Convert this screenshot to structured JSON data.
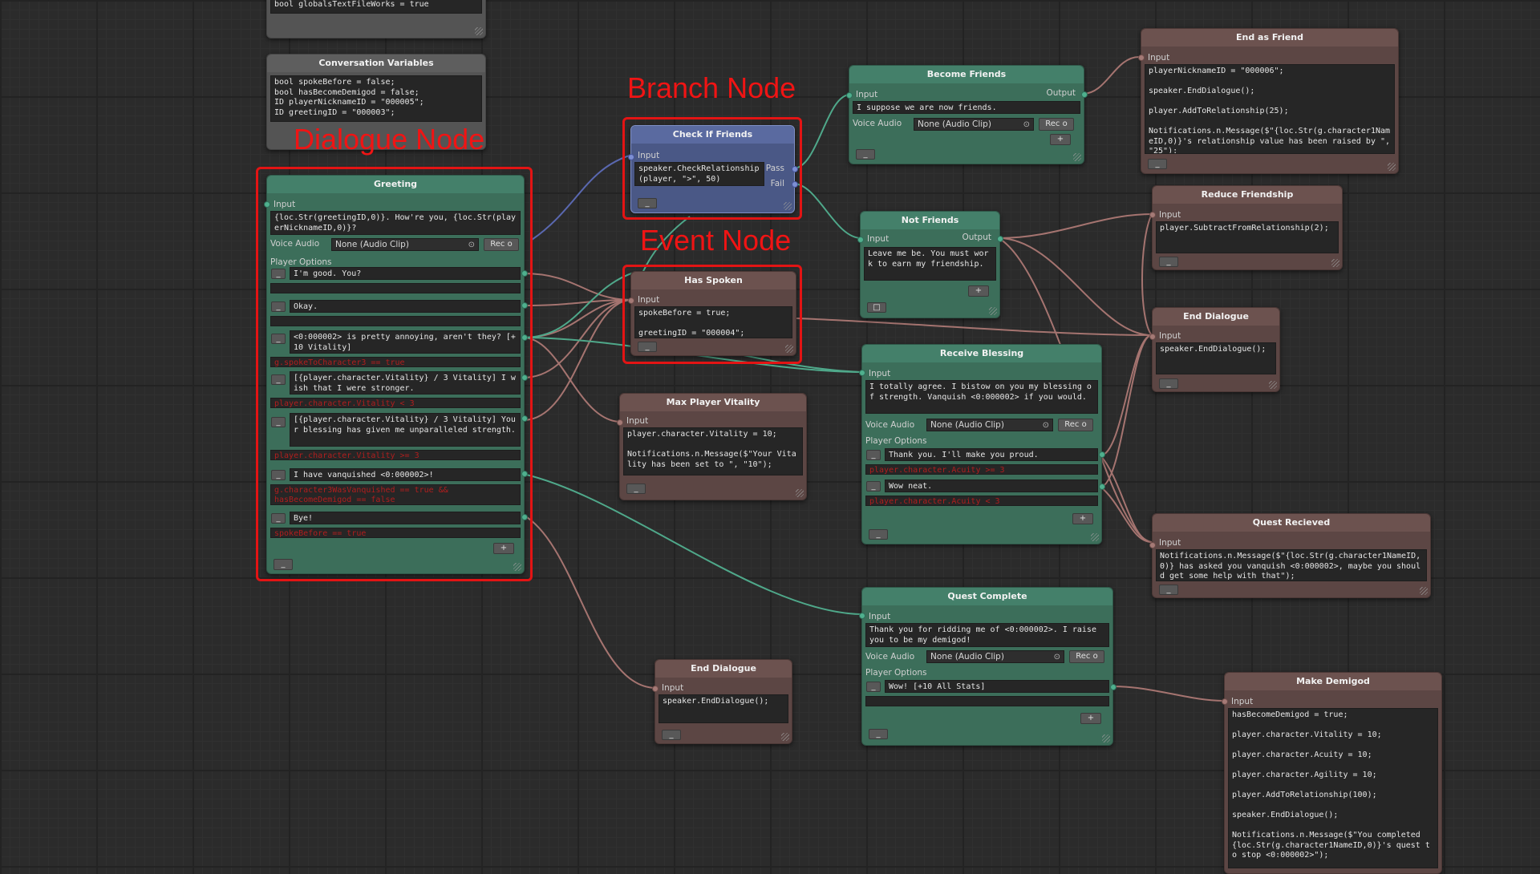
{
  "annotations": {
    "branch_node": "Branch Node",
    "dialogue_node": "Dialogue Node",
    "event_node": "Event Node"
  },
  "common": {
    "input": "Input",
    "output": "Output",
    "voice_audio": "Voice Audio",
    "audio_clip": "None (Audio Clip)",
    "record": "Rec o",
    "player_options": "Player Options",
    "minus": "_",
    "plus": "+",
    "square": "□",
    "target_glyph": "⊙"
  },
  "globals_node": {
    "text": "bool globalsTextFileWorks = true"
  },
  "conversation_variables": {
    "title": "Conversation Variables",
    "code": "bool spokeBefore = false;\nbool hasBecomeDemigod = false;\nID playerNicknameID = \"000005\";\nID greetingID = \"000003\";"
  },
  "greeting": {
    "title": "Greeting",
    "text": "{loc.Str(greetingID,0)}. How're you, {loc.Str(playerNicknameID,0)}?",
    "options": [
      {
        "text": "I'm good. You?",
        "condition": ""
      },
      {
        "text": "Okay.",
        "condition": ""
      },
      {
        "text": "<0:000002> is pretty annoying, aren't they? [+10 Vitality]",
        "condition": "g.spokeToCharacter3 == true"
      },
      {
        "text": "[{player.character.Vitality} / 3 Vitality] I wish that I were stronger.",
        "condition": "player.character.Vitality < 3"
      },
      {
        "text": "[{player.character.Vitality} / 3 Vitality] Your blessing has given me unparalleled strength.",
        "condition": "player.character.Vitality >= 3"
      },
      {
        "text": "I have vanquished <0:000002>!",
        "condition": "g.character3WasVanquished == true &&\nhasBecomeDemigod == false"
      },
      {
        "text": "Bye!",
        "condition": "spokeBefore == true"
      }
    ]
  },
  "check_if_friends": {
    "title": "Check If Friends",
    "code": "speaker.CheckRelationship(player, \">\", 50)",
    "pass": "Pass",
    "fail": "Fail"
  },
  "has_spoken": {
    "title": "Has Spoken",
    "code": "spokeBefore = true;\n\ngreetingID = \"000004\";"
  },
  "max_player_vitality": {
    "title": "Max Player Vitality",
    "code": "player.character.Vitality = 10;\n\nNotifications.n.Message($\"Your Vitality has been set to \", \"10\");"
  },
  "end_dialogue_bottom": {
    "title": "End Dialogue",
    "code": "speaker.EndDialogue();"
  },
  "become_friends": {
    "title": "Become Friends",
    "text": "I suppose we are now friends."
  },
  "not_friends": {
    "title": "Not Friends",
    "text": "Leave me be. You must work to earn my friendship."
  },
  "receive_blessing": {
    "title": "Receive Blessing",
    "text": "I totally agree. I bistow on you my blessing of strength. Vanquish <0:000002> if you would.",
    "options": [
      {
        "text": "Thank you. I'll make you proud.",
        "condition": "player.character.Acuity >= 3"
      },
      {
        "text": "Wow neat.",
        "condition": "player.character.Acuity < 3"
      }
    ]
  },
  "quest_complete": {
    "title": "Quest Complete",
    "text": "Thank you for ridding me of <0:000002>. I raise you to be my demigod!",
    "options": [
      {
        "text": "Wow! [+10 All Stats]",
        "condition": ""
      }
    ]
  },
  "end_as_friend": {
    "title": "End as Friend",
    "code": "playerNicknameID = \"000006\";\n\nspeaker.EndDialogue();\n\nplayer.AddToRelationship(25);\n\nNotifications.n.Message($\"{loc.Str(g.character1NameID,0)}'s relationship value has been raised by \", \"25\");"
  },
  "reduce_friendship": {
    "title": "Reduce Friendship",
    "code": "player.SubtractFromRelationship(2);"
  },
  "end_dialogue_right": {
    "title": "End Dialogue",
    "code": "speaker.EndDialogue();"
  },
  "quest_recieved": {
    "title": "Quest Recieved",
    "code": "Notifications.n.Message($\"{loc.Str(g.character1NameID,0)} has asked you vanquish <0:000002>, maybe you should get some help with that\");"
  },
  "make_demigod": {
    "title": "Make Demigod",
    "code": "hasBecomeDemigod = true;\n\nplayer.character.Vitality = 10;\n\nplayer.character.Acuity = 10;\n\nplayer.character.Agility = 10;\n\nplayer.AddToRelationship(100);\n\nspeaker.EndDialogue();\n\nNotifications.n.Message($\"You completed {loc.Str(g.character1NameID,0)}'s quest to stop <0:000002>\");"
  },
  "colors": {
    "dialogue_wire": "#4fa88a",
    "event_wire": "#a57470",
    "branch_wire": "#5a68b0",
    "highlight": "#e31414"
  }
}
